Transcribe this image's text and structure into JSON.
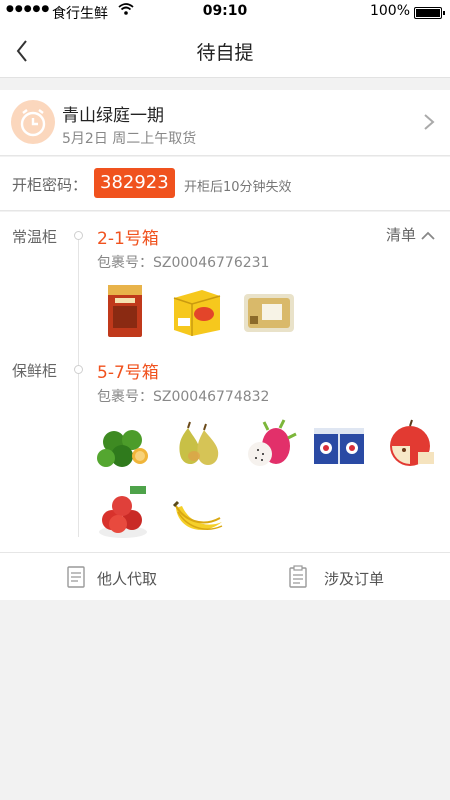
{
  "status": {
    "signal": "●●●●●",
    "carrier": "食行生鲜",
    "time": "09:10",
    "battery": "100%"
  },
  "nav": {
    "title": "待自提"
  },
  "pickup": {
    "location": "青山绿庭一期",
    "date": "5月2日 周二上午取货"
  },
  "code": {
    "label": "开柜密码：",
    "value": "382923",
    "hint": "开柜后10分钟失效"
  },
  "lockers": [
    {
      "type": "常温柜",
      "box": "2-1号箱",
      "parcel": "包裹号：SZ00046776231",
      "items": [
        "spicy-snack-bag-image",
        "biscuit-box-image",
        "tissue-pack-image"
      ]
    },
    {
      "type": "保鲜柜",
      "box": "5-7号箱",
      "parcel": "包裹号：SZ00046774832",
      "items": [
        "green-oranges-image",
        "pears-image",
        "dragon-fruit-image",
        "yogurt-pack-image",
        "apple-image",
        "red-apples-image",
        "bananas-image"
      ]
    }
  ],
  "list_toggle": "清单",
  "actions": {
    "proxy": "他人代取",
    "orders": "涉及订单"
  },
  "colors": {
    "accent": "#f0521e",
    "clock_bg": "#fbd7bd"
  }
}
